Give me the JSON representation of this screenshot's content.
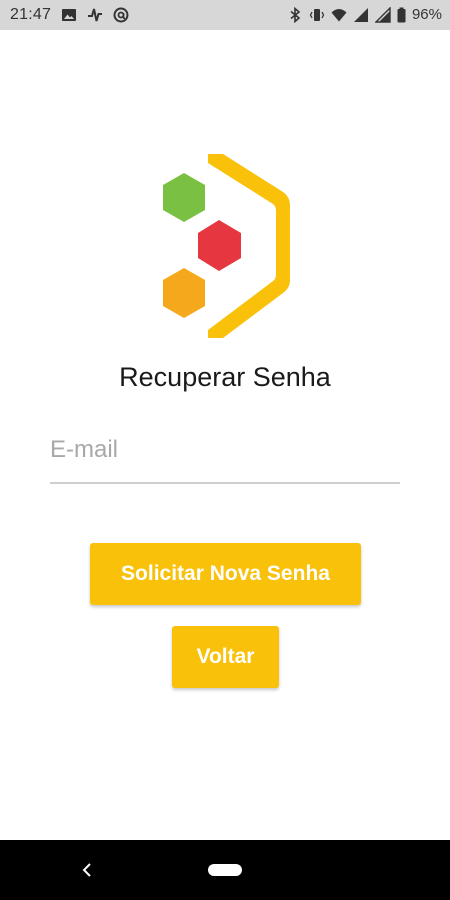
{
  "status_bar": {
    "time": "21:47",
    "battery_percent": "96%",
    "left_icons": [
      "image-icon",
      "activity-icon",
      "at-sign-icon"
    ],
    "right_icons": [
      "bluetooth-icon",
      "vibrate-icon",
      "wifi-icon",
      "signal-icon",
      "signal-icon",
      "battery-icon"
    ]
  },
  "logo": {
    "colors": {
      "green": "#7ac143",
      "red": "#e63740",
      "orange": "#f5a81c",
      "frame": "#f9c10a"
    }
  },
  "title": "Recuperar Senha",
  "email": {
    "placeholder": "E-mail",
    "value": ""
  },
  "buttons": {
    "request_label": "Solicitar Nova Senha",
    "back_label": "Voltar"
  },
  "colors": {
    "accent": "#f9c10a",
    "status_bar_bg": "#d7d7d7",
    "nav_bar_bg": "#000000"
  }
}
